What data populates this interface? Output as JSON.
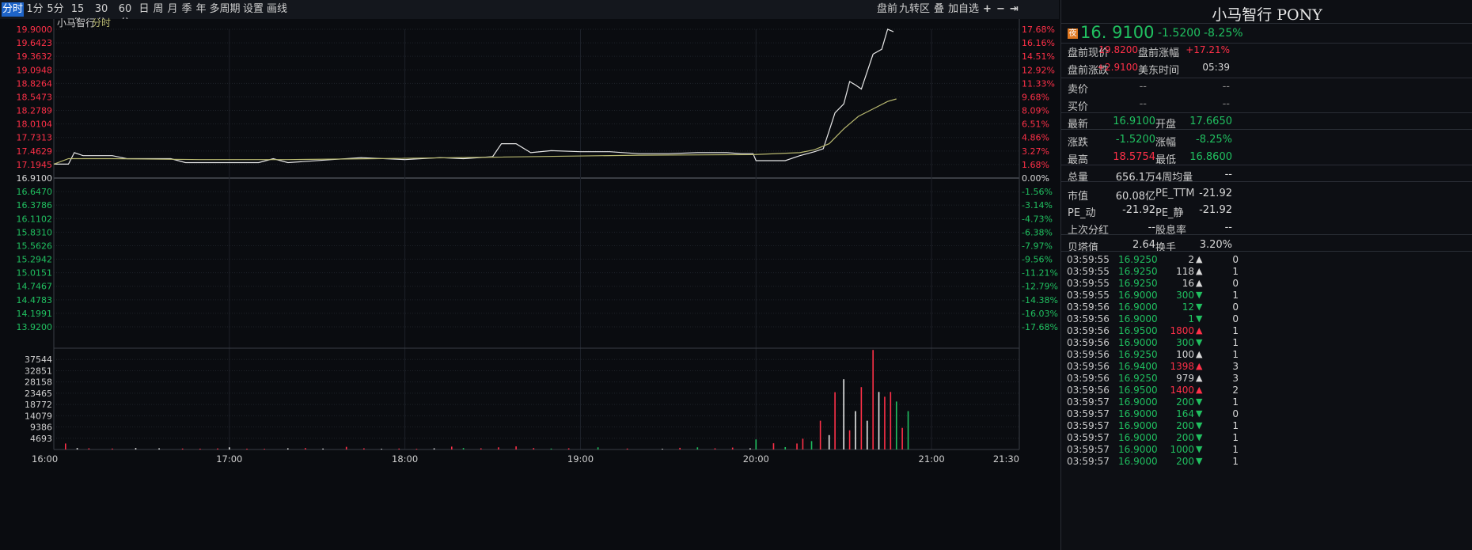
{
  "toolbar": {
    "periods": [
      "分时",
      "1分",
      "5分",
      "15分",
      "30分",
      "60分",
      "日",
      "周",
      "月",
      "季",
      "年",
      "多周期",
      "设置",
      "画线"
    ],
    "right_tools": [
      "盘前",
      "九转",
      "区",
      "叠",
      "加自选"
    ],
    "icons": [
      "plus-icon",
      "minus-icon",
      "expand-icon"
    ]
  },
  "chart_header": {
    "name": "小马智行",
    "mode": "分时"
  },
  "chart_data": {
    "type": "line",
    "price_axis_left": [
      "19.9000",
      "19.6423",
      "19.3632",
      "19.0948",
      "18.8264",
      "18.5473",
      "18.2789",
      "18.0104",
      "17.7313",
      "17.4629",
      "17.1945",
      "16.9100",
      "16.6470",
      "16.3786",
      "16.1102",
      "15.8310",
      "15.5626",
      "15.2942",
      "15.0151",
      "14.7467",
      "14.4783",
      "14.1991",
      "13.9200"
    ],
    "pct_axis_right": [
      "17.68%",
      "16.16%",
      "14.51%",
      "12.92%",
      "11.33%",
      "9.68%",
      "8.09%",
      "6.51%",
      "4.86%",
      "3.27%",
      "1.68%",
      "0.00%",
      "-1.56%",
      "-3.14%",
      "-4.73%",
      "-6.38%",
      "-7.97%",
      "-9.56%",
      "-11.21%",
      "-12.79%",
      "-14.38%",
      "-16.03%",
      "-17.68%"
    ],
    "prev_close": 16.91,
    "ylim": [
      13.92,
      19.9
    ],
    "volume_axis": [
      "37544",
      "32851",
      "28158",
      "23465",
      "18772",
      "14079",
      "9386",
      "4693"
    ],
    "volume_max": 42237,
    "time_axis": [
      "16:00",
      "17:00",
      "18:00",
      "19:00",
      "20:00",
      "21:00",
      "21:30"
    ],
    "xlim_minutes": [
      0,
      330
    ],
    "series": [
      {
        "role": "price",
        "color": "#e8e8e8",
        "points": [
          [
            0,
            17.19
          ],
          [
            5,
            17.19
          ],
          [
            7,
            17.42
          ],
          [
            10,
            17.36
          ],
          [
            20,
            17.36
          ],
          [
            25,
            17.3
          ],
          [
            30,
            17.3
          ],
          [
            40,
            17.3
          ],
          [
            45,
            17.22
          ],
          [
            60,
            17.22
          ],
          [
            70,
            17.22
          ],
          [
            75,
            17.3
          ],
          [
            80,
            17.22
          ],
          [
            95,
            17.28
          ],
          [
            105,
            17.32
          ],
          [
            120,
            17.28
          ],
          [
            132,
            17.32
          ],
          [
            140,
            17.3
          ],
          [
            150,
            17.34
          ],
          [
            153,
            17.6
          ],
          [
            158,
            17.6
          ],
          [
            163,
            17.42
          ],
          [
            170,
            17.46
          ],
          [
            180,
            17.44
          ],
          [
            190,
            17.44
          ],
          [
            200,
            17.4
          ],
          [
            210,
            17.4
          ],
          [
            220,
            17.42
          ],
          [
            230,
            17.42
          ],
          [
            235,
            17.4
          ],
          [
            239,
            17.4
          ],
          [
            240,
            17.26
          ],
          [
            250,
            17.26
          ],
          [
            255,
            17.36
          ],
          [
            260,
            17.44
          ],
          [
            263,
            17.5
          ],
          [
            265,
            17.86
          ],
          [
            267,
            18.22
          ],
          [
            270,
            18.4
          ],
          [
            272,
            18.85
          ],
          [
            274,
            18.78
          ],
          [
            276,
            18.7
          ],
          [
            280,
            19.4
          ],
          [
            283,
            19.5
          ],
          [
            285,
            19.9
          ],
          [
            287,
            19.85
          ]
        ]
      },
      {
        "role": "avg",
        "color": "#b8b870",
        "points": [
          [
            0,
            17.19
          ],
          [
            5,
            17.3
          ],
          [
            20,
            17.3
          ],
          [
            50,
            17.28
          ],
          [
            80,
            17.28
          ],
          [
            110,
            17.3
          ],
          [
            150,
            17.33
          ],
          [
            200,
            17.37
          ],
          [
            239,
            17.38
          ],
          [
            255,
            17.42
          ],
          [
            260,
            17.48
          ],
          [
            265,
            17.6
          ],
          [
            270,
            17.9
          ],
          [
            275,
            18.15
          ],
          [
            280,
            18.3
          ],
          [
            285,
            18.45
          ],
          [
            288,
            18.5
          ]
        ]
      }
    ],
    "volume": [
      {
        "t": 4,
        "v": 2500,
        "c": "r"
      },
      {
        "t": 8,
        "v": 600,
        "c": "w"
      },
      {
        "t": 12,
        "v": 500,
        "c": "r"
      },
      {
        "t": 20,
        "v": 400,
        "c": "r"
      },
      {
        "t": 28,
        "v": 600,
        "c": "w"
      },
      {
        "t": 36,
        "v": 500,
        "c": "w"
      },
      {
        "t": 44,
        "v": 400,
        "c": "r"
      },
      {
        "t": 50,
        "v": 350,
        "c": "r"
      },
      {
        "t": 56,
        "v": 450,
        "c": "r"
      },
      {
        "t": 60,
        "v": 900,
        "c": "w"
      },
      {
        "t": 66,
        "v": 350,
        "c": "r"
      },
      {
        "t": 72,
        "v": 300,
        "c": "r"
      },
      {
        "t": 80,
        "v": 500,
        "c": "w"
      },
      {
        "t": 86,
        "v": 600,
        "c": "r"
      },
      {
        "t": 92,
        "v": 400,
        "c": "w"
      },
      {
        "t": 100,
        "v": 1100,
        "c": "r"
      },
      {
        "t": 106,
        "v": 500,
        "c": "r"
      },
      {
        "t": 112,
        "v": 300,
        "c": "w"
      },
      {
        "t": 118,
        "v": 400,
        "c": "r"
      },
      {
        "t": 124,
        "v": 300,
        "c": "r"
      },
      {
        "t": 130,
        "v": 500,
        "c": "w"
      },
      {
        "t": 136,
        "v": 1200,
        "c": "r"
      },
      {
        "t": 140,
        "v": 600,
        "c": "g"
      },
      {
        "t": 146,
        "v": 500,
        "c": "r"
      },
      {
        "t": 152,
        "v": 900,
        "c": "r"
      },
      {
        "t": 158,
        "v": 1300,
        "c": "r"
      },
      {
        "t": 164,
        "v": 600,
        "c": "r"
      },
      {
        "t": 170,
        "v": 400,
        "c": "g"
      },
      {
        "t": 176,
        "v": 500,
        "c": "r"
      },
      {
        "t": 186,
        "v": 900,
        "c": "g"
      },
      {
        "t": 196,
        "v": 400,
        "c": "r"
      },
      {
        "t": 208,
        "v": 300,
        "c": "w"
      },
      {
        "t": 214,
        "v": 700,
        "c": "r"
      },
      {
        "t": 220,
        "v": 900,
        "c": "g"
      },
      {
        "t": 226,
        "v": 500,
        "c": "r"
      },
      {
        "t": 232,
        "v": 800,
        "c": "r"
      },
      {
        "t": 238,
        "v": 500,
        "c": "w"
      },
      {
        "t": 240,
        "v": 4200,
        "c": "g"
      },
      {
        "t": 246,
        "v": 2600,
        "c": "r"
      },
      {
        "t": 250,
        "v": 1000,
        "c": "g"
      },
      {
        "t": 254,
        "v": 2500,
        "c": "r"
      },
      {
        "t": 256,
        "v": 4500,
        "c": "r"
      },
      {
        "t": 259,
        "v": 3500,
        "c": "g"
      },
      {
        "t": 262,
        "v": 12000,
        "c": "r"
      },
      {
        "t": 265,
        "v": 6000,
        "c": "w"
      },
      {
        "t": 267,
        "v": 23900,
        "c": "r"
      },
      {
        "t": 270,
        "v": 29300,
        "c": "w"
      },
      {
        "t": 272,
        "v": 8000,
        "c": "r"
      },
      {
        "t": 274,
        "v": 16000,
        "c": "w"
      },
      {
        "t": 276,
        "v": 26000,
        "c": "r"
      },
      {
        "t": 278,
        "v": 12000,
        "c": "w"
      },
      {
        "t": 280,
        "v": 41500,
        "c": "r"
      },
      {
        "t": 282,
        "v": 24000,
        "c": "w"
      },
      {
        "t": 284,
        "v": 22000,
        "c": "r"
      },
      {
        "t": 286,
        "v": 24000,
        "c": "r"
      },
      {
        "t": 288,
        "v": 20000,
        "c": "g"
      },
      {
        "t": 290,
        "v": 9000,
        "c": "r"
      },
      {
        "t": 292,
        "v": 16000,
        "c": "g"
      }
    ]
  },
  "quote": {
    "title": "小马智行 PONY",
    "badge": "夜",
    "price": "16. 9100",
    "change": "-1.5200",
    "change_pct": "-8.25%",
    "pre_rows": [
      {
        "l1": "盘前现价",
        "v1": "19.8200",
        "l2": "盘前涨幅",
        "v2": "+17.21%"
      },
      {
        "l1": "盘前涨跌",
        "v1": "+2.9100",
        "l2": "美东时间",
        "v2": "05:39"
      }
    ],
    "ask_label": "卖价",
    "bid_label": "买价",
    "ask_vals": [
      "--",
      "--"
    ],
    "bid_vals": [
      "--",
      "--"
    ],
    "stats": [
      {
        "l1": "最新",
        "v1": "16.9100",
        "c1": "green",
        "l2": "开盘",
        "v2": "17.6650",
        "c2": "green"
      },
      {
        "l1": "涨跌",
        "v1": "-1.5200",
        "c1": "green",
        "l2": "涨幅",
        "v2": "-8.25%",
        "c2": "green"
      },
      {
        "l1": "最高",
        "v1": "18.5754",
        "c1": "red",
        "l2": "最低",
        "v2": "16.8600",
        "c2": "green"
      },
      {
        "l1": "总量",
        "v1": "656.1万",
        "c1": "wht",
        "l2": "4周均量",
        "v2": "--",
        "c2": "wht"
      },
      {
        "l1": "市值",
        "v1": "60.08亿",
        "c1": "wht",
        "l2": "PE_TTM",
        "v2": "-21.92",
        "c2": "wht"
      },
      {
        "l1": "PE_动",
        "v1": "-21.92",
        "c1": "wht",
        "l2": "PE_静",
        "v2": "-21.92",
        "c2": "wht"
      },
      {
        "l1": "上次分红",
        "v1": "--",
        "c1": "wht",
        "l2": "股息率",
        "v2": "--",
        "c2": "wht"
      },
      {
        "l1": "贝塔值",
        "v1": "2.64",
        "c1": "wht",
        "l2": "换手",
        "v2": "3.20%",
        "c2": "wht"
      }
    ],
    "ticks": [
      {
        "time": "03:59:55",
        "price": "16.9250",
        "pc": "green",
        "vol": "2",
        "vc": "wht",
        "dir": "up",
        "cnt": "0"
      },
      {
        "time": "03:59:55",
        "price": "16.9250",
        "pc": "green",
        "vol": "118",
        "vc": "wht",
        "dir": "up",
        "cnt": "1"
      },
      {
        "time": "03:59:55",
        "price": "16.9250",
        "pc": "green",
        "vol": "16",
        "vc": "wht",
        "dir": "up",
        "cnt": "0"
      },
      {
        "time": "03:59:55",
        "price": "16.9000",
        "pc": "green",
        "vol": "300",
        "vc": "green",
        "dir": "down",
        "cnt": "1"
      },
      {
        "time": "03:59:56",
        "price": "16.9000",
        "pc": "green",
        "vol": "12",
        "vc": "green",
        "dir": "down",
        "cnt": "0"
      },
      {
        "time": "03:59:56",
        "price": "16.9000",
        "pc": "green",
        "vol": "1",
        "vc": "green",
        "dir": "down",
        "cnt": "0"
      },
      {
        "time": "03:59:56",
        "price": "16.9500",
        "pc": "green",
        "vol": "1800",
        "vc": "red",
        "dir": "up",
        "cnt": "1"
      },
      {
        "time": "03:59:56",
        "price": "16.9000",
        "pc": "green",
        "vol": "300",
        "vc": "green",
        "dir": "down",
        "cnt": "1"
      },
      {
        "time": "03:59:56",
        "price": "16.9250",
        "pc": "green",
        "vol": "100",
        "vc": "wht",
        "dir": "up",
        "cnt": "1"
      },
      {
        "time": "03:59:56",
        "price": "16.9400",
        "pc": "green",
        "vol": "1398",
        "vc": "red",
        "dir": "up",
        "cnt": "3"
      },
      {
        "time": "03:59:56",
        "price": "16.9250",
        "pc": "green",
        "vol": "979",
        "vc": "wht",
        "dir": "up",
        "cnt": "3"
      },
      {
        "time": "03:59:56",
        "price": "16.9500",
        "pc": "green",
        "vol": "1400",
        "vc": "red",
        "dir": "up",
        "cnt": "2"
      },
      {
        "time": "03:59:57",
        "price": "16.9000",
        "pc": "green",
        "vol": "200",
        "vc": "green",
        "dir": "down",
        "cnt": "1"
      },
      {
        "time": "03:59:57",
        "price": "16.9000",
        "pc": "green",
        "vol": "164",
        "vc": "green",
        "dir": "down",
        "cnt": "0"
      },
      {
        "time": "03:59:57",
        "price": "16.9000",
        "pc": "green",
        "vol": "200",
        "vc": "green",
        "dir": "down",
        "cnt": "1"
      },
      {
        "time": "03:59:57",
        "price": "16.9000",
        "pc": "green",
        "vol": "200",
        "vc": "green",
        "dir": "down",
        "cnt": "1"
      },
      {
        "time": "03:59:57",
        "price": "16.9000",
        "pc": "green",
        "vol": "1000",
        "vc": "green",
        "dir": "down",
        "cnt": "1"
      },
      {
        "time": "03:59:57",
        "price": "16.9000",
        "pc": "green",
        "vol": "200",
        "vc": "green",
        "dir": "down",
        "cnt": "1"
      }
    ]
  },
  "colors": {
    "up": "#ff3048",
    "down": "#20c060",
    "bg": "#0a0c10",
    "grid": "#1e2229",
    "price_line": "#e8e8e8",
    "avg_line": "#b8b870"
  }
}
